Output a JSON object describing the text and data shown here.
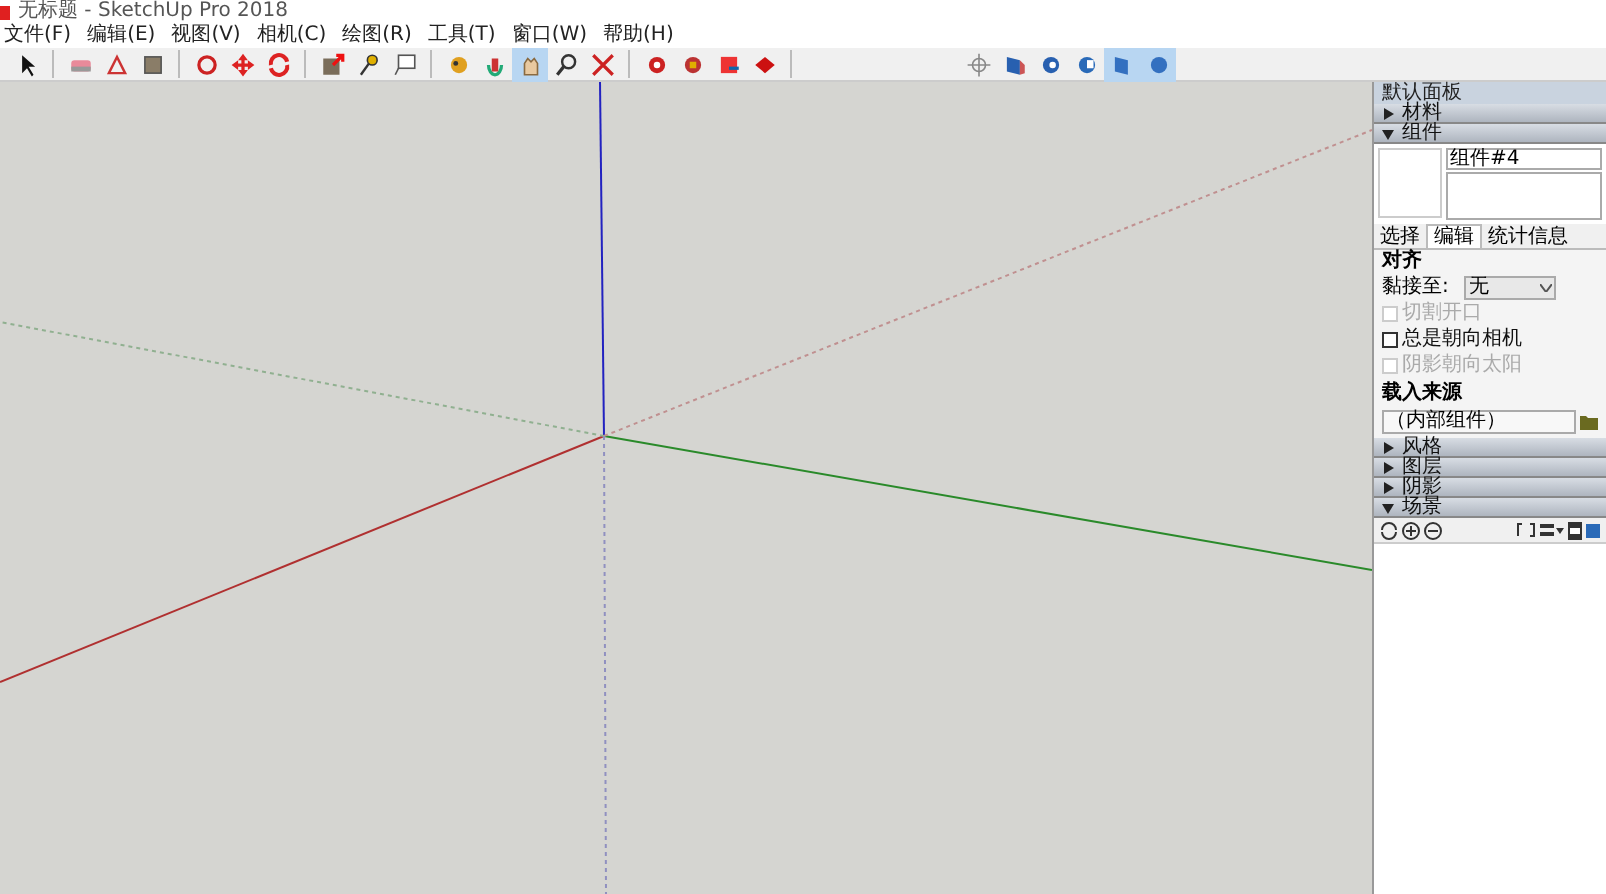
{
  "window": {
    "title": "无标题 - SketchUp Pro 2018"
  },
  "menu": [
    "文件(F)",
    "编辑(E)",
    "视图(V)",
    "相机(C)",
    "绘图(R)",
    "工具(T)",
    "窗口(W)",
    "帮助(H)"
  ],
  "toolbar": [
    {
      "selected": false
    },
    {
      "selected": false
    },
    {
      "selected": false
    },
    {
      "selected": false
    },
    {
      "selected": false
    },
    {
      "selected": false
    },
    {
      "selected": false
    },
    {
      "selected": false
    },
    {
      "selected": false
    },
    {
      "selected": false
    },
    {
      "selected": false
    },
    {
      "selected": false
    },
    {
      "selected": true
    },
    {
      "selected": false
    },
    {
      "selected": false
    },
    {
      "selected": false
    },
    {
      "selected": false
    },
    {
      "selected": false
    },
    {
      "selected": false
    },
    {
      "selected": false
    },
    {
      "selected": false
    },
    {
      "selected": false
    },
    {
      "selected": false
    },
    {
      "selected": true
    },
    {
      "selected": true
    }
  ],
  "tray": {
    "title": "默认面板",
    "sections_top": [
      {
        "label": "材料",
        "expanded": false
      },
      {
        "label": "组件",
        "expanded": true
      }
    ],
    "component": {
      "name": "组件#4",
      "tabs": [
        {
          "label": "选择",
          "selected": false
        },
        {
          "label": "编辑",
          "selected": true
        },
        {
          "label": "统计信息",
          "selected": false
        }
      ],
      "alignment_heading": "对齐",
      "glue_label": "黏接至:",
      "glue_value": "无",
      "options": [
        {
          "label": "切割开口",
          "checked": false,
          "disabled": true
        },
        {
          "label": "总是朝向相机",
          "checked": false,
          "disabled": false
        },
        {
          "label": "阴影朝向太阳",
          "checked": false,
          "disabled": true
        }
      ],
      "load_heading": "载入来源",
      "load_value": "（内部组件）"
    },
    "sections_bottom": [
      {
        "label": "风格",
        "expanded": false
      },
      {
        "label": "图层",
        "expanded": false
      },
      {
        "label": "阴影",
        "expanded": false
      },
      {
        "label": "场景",
        "expanded": true
      }
    ]
  }
}
